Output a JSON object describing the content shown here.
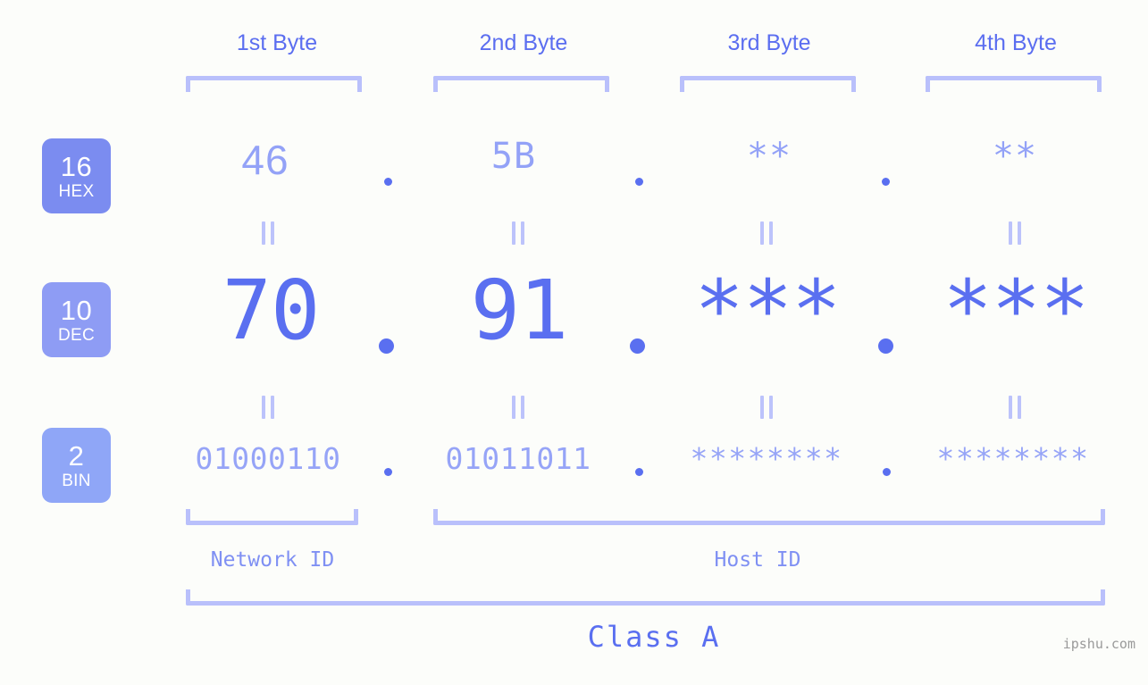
{
  "background_color": "#fcfdfa",
  "accent_color": "#5a6ff0",
  "accent_light_color": "#96a4f7",
  "bracket_color": "#b9c0fb",
  "headers": [
    {
      "label": "1st Byte"
    },
    {
      "label": "2nd Byte"
    },
    {
      "label": "3rd Byte"
    },
    {
      "label": "4th Byte"
    }
  ],
  "radix_badges": [
    {
      "number": "16",
      "name": "HEX",
      "color": "#7b8cf0"
    },
    {
      "number": "10",
      "name": "DEC",
      "color": "#8e9cf4"
    },
    {
      "number": "2",
      "name": "BIN",
      "color": "#8fa6f7"
    }
  ],
  "rows": {
    "hex": {
      "radix": "16",
      "radix_name": "HEX",
      "values": [
        "46",
        "5B",
        "**",
        "**"
      ],
      "separator": "."
    },
    "dec": {
      "radix": "10",
      "radix_name": "DEC",
      "values": [
        "70",
        "91",
        "***",
        "***"
      ],
      "separator": "."
    },
    "bin": {
      "radix": "2",
      "radix_name": "BIN",
      "values": [
        "01000110",
        "01011011",
        "********",
        "********"
      ],
      "separator": "."
    }
  },
  "equals_symbol": "=",
  "sections": {
    "network_id": "Network ID",
    "host_id": "Host ID",
    "class": "Class A"
  },
  "watermark": "ipshu.com"
}
